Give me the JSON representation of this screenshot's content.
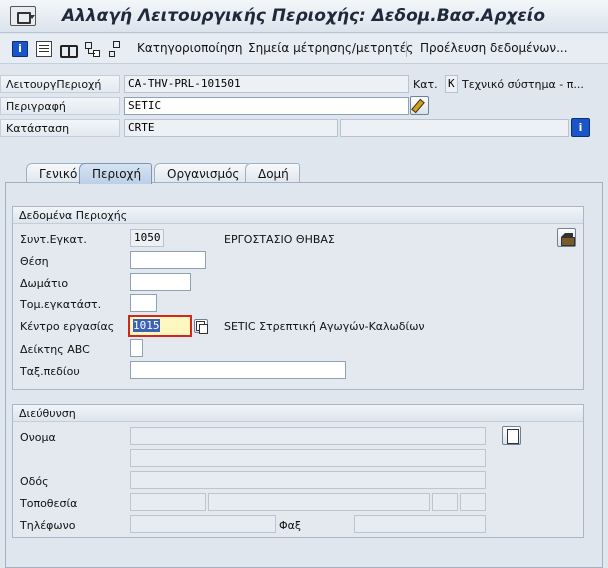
{
  "window": {
    "title": "Αλλαγή Λειτουργικής Περιοχής: Δεδομ.Βασ.Αρχείο"
  },
  "toolbar": {
    "categorization": "Κατηγοριοποίηση",
    "measurement_points": "Σημεία μέτρησης/μετρητές",
    "data_origin": "Προέλευση δεδομένων..."
  },
  "header": {
    "func_location_label": "ΛειτουργΠεριοχή",
    "func_location_value": "CA-THV-PRL-101501",
    "category_label": "Κατ.",
    "category_value": "K",
    "category_text": "Τεχνικό σύστημα - π...",
    "description_label": "Περιγραφή",
    "description_value": "SETIC",
    "status_label": "Κατάσταση",
    "status_value": "CRTE"
  },
  "tabs": [
    {
      "label": "Γενικό"
    },
    {
      "label": "Περιοχή"
    },
    {
      "label": "Οργανισμός"
    },
    {
      "label": "Δομή"
    }
  ],
  "location_group": {
    "title": "Δεδομένα Περιοχής",
    "plant_label": "Συντ.Εγκατ.",
    "plant_value": "1050",
    "plant_text": "ΕΡΓΟΣΤΑΣΙΟ ΘΗΒΑΣ",
    "position_label": "Θέση",
    "room_label": "Δωμάτιο",
    "plant_section_label": "Τομ.εγκατάστ.",
    "work_center_label": "Κέντρο εργασίας",
    "work_center_value": "1015",
    "work_center_text": "SETIC Στρεπτική Αγωγών-Καλωδίων",
    "abc_label": "Δείκτης ABC",
    "sort_field_label": "Ταξ.πεδίου"
  },
  "address_group": {
    "title": "Διεύθυνση",
    "name_label": "Ονομα",
    "street_label": "Οδός",
    "location_label": "Τοποθεσία",
    "phone_label": "Τηλέφωνο",
    "fax_label": "Φαξ"
  }
}
